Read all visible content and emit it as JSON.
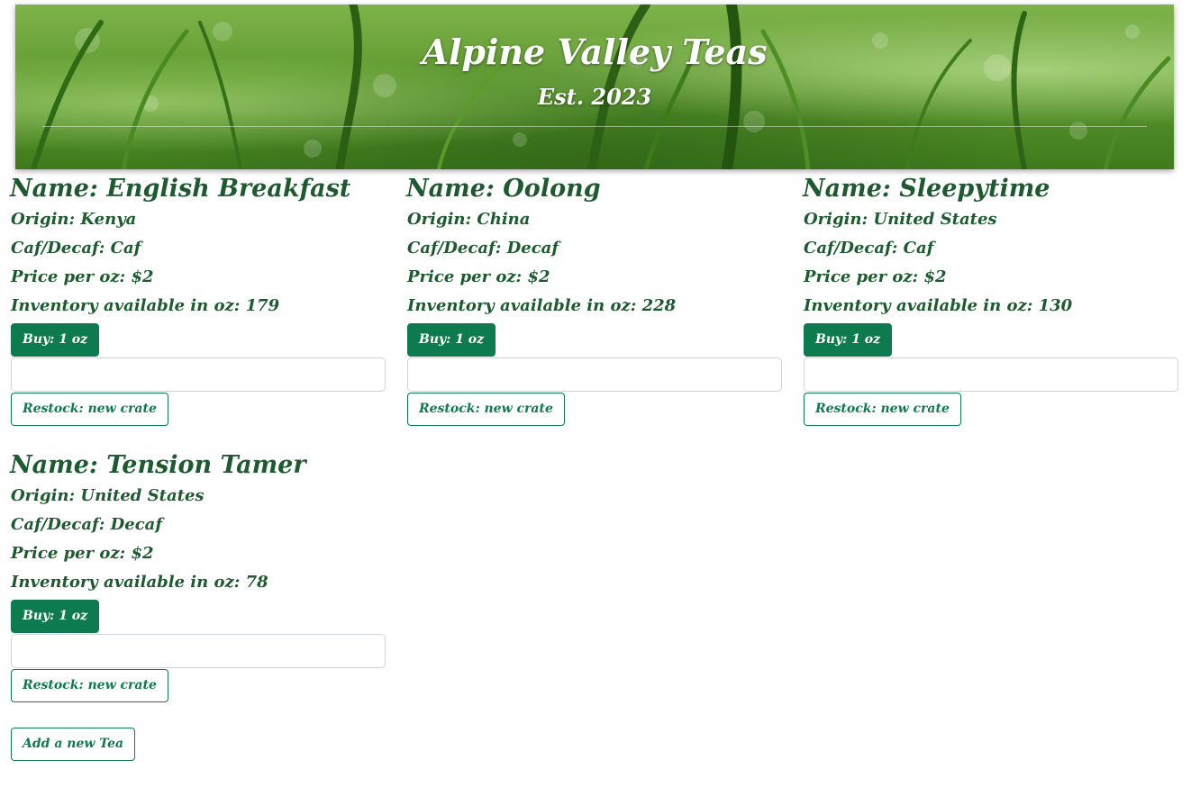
{
  "header": {
    "title": "Alpine Valley Teas",
    "subtitle": "Est. 2023"
  },
  "teas": [
    {
      "name": "Name: English Breakfast",
      "origin": "Origin: Kenya",
      "caf": "Caf/Decaf: Caf",
      "price": "Price per oz: $2",
      "inventory": "Inventory available in oz: 179",
      "buy_label": "Buy: 1 oz",
      "input_value": "",
      "restock_label": "Restock: new crate"
    },
    {
      "name": "Name: Oolong",
      "origin": "Origin: China",
      "caf": "Caf/Decaf: Decaf",
      "price": "Price per oz: $2",
      "inventory": "Inventory available in oz: 228",
      "buy_label": "Buy: 1 oz",
      "input_value": "",
      "restock_label": "Restock: new crate"
    },
    {
      "name": "Name: Sleepytime",
      "origin": "Origin: United States",
      "caf": "Caf/Decaf: Caf",
      "price": "Price per oz: $2",
      "inventory": "Inventory available in oz: 130",
      "buy_label": "Buy: 1 oz",
      "input_value": "",
      "restock_label": "Restock: new crate"
    },
    {
      "name": "Name: Tension Tamer",
      "origin": "Origin: United States",
      "caf": "Caf/Decaf: Decaf",
      "price": "Price per oz: $2",
      "inventory": "Inventory available in oz: 78",
      "buy_label": "Buy: 1 oz",
      "input_value": "",
      "restock_label": "Restock: new crate"
    }
  ],
  "actions": {
    "add_tea_label": "Add a new Tea"
  },
  "colors": {
    "text_green": "#1d5a2f",
    "button_green": "#0e7a4f",
    "banner": "grass-photo"
  }
}
